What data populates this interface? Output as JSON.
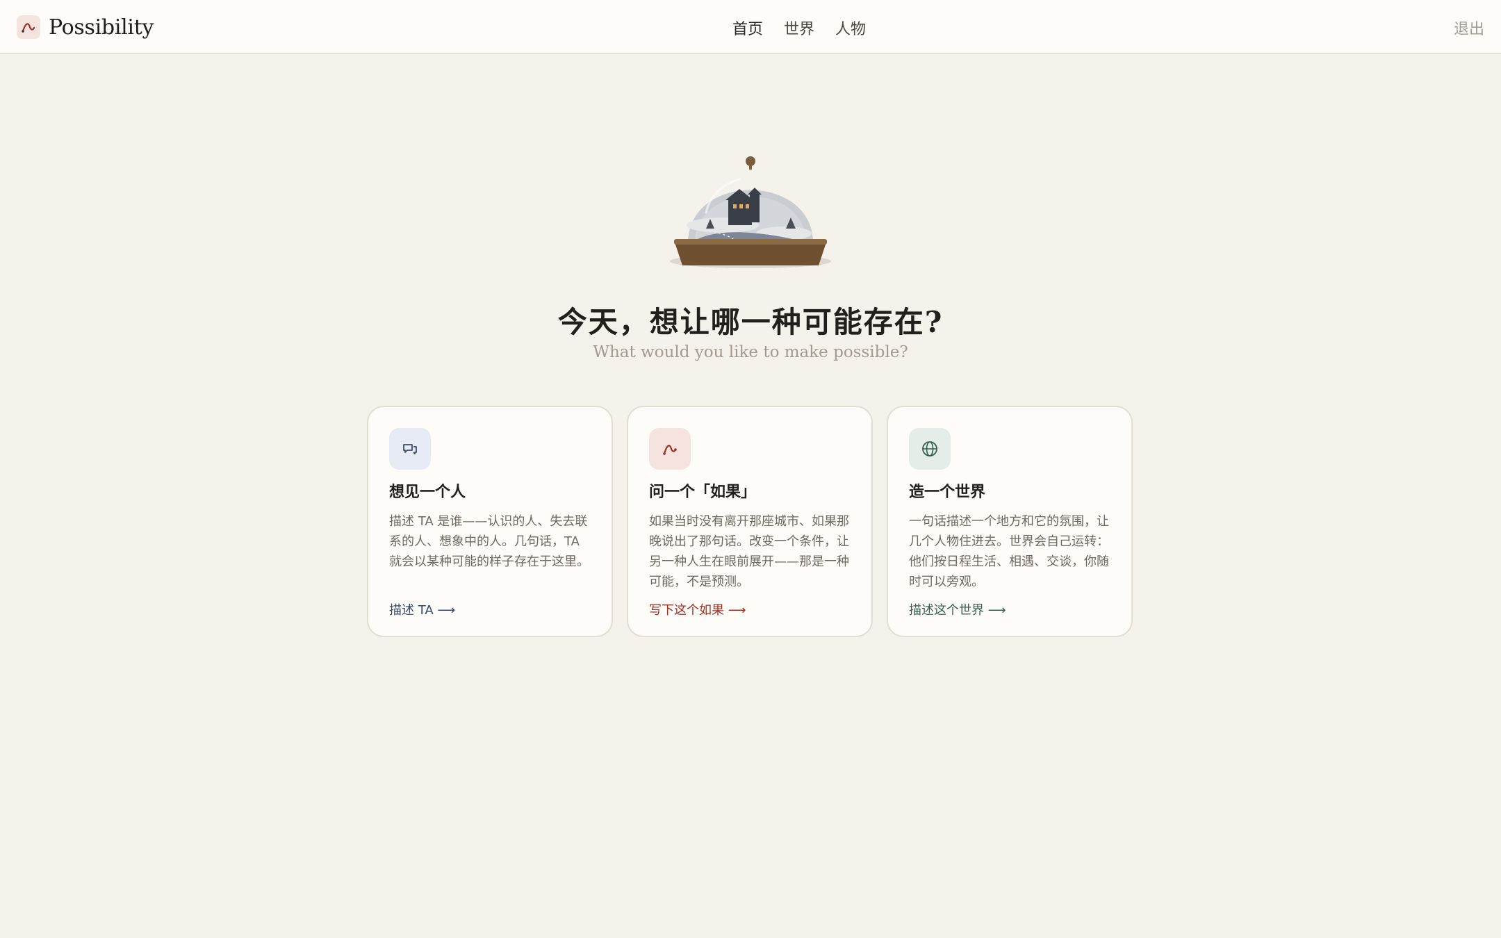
{
  "app": {
    "name": "Possibility",
    "logo_icon": "curve-icon",
    "accent": "#9c2f22"
  },
  "nav": {
    "items": [
      {
        "label": "首页",
        "active": true
      },
      {
        "label": "世界",
        "active": false
      },
      {
        "label": "人物",
        "active": false
      }
    ],
    "logout_label": "退出"
  },
  "hero": {
    "illustration": "snow-globe-house-illustration",
    "title": "今天，想让哪一种可能存在?",
    "subtitle": "What would you like to make possible?"
  },
  "cards": [
    {
      "icon": "chat-bubble-icon",
      "icon_color": "#3b4a6b",
      "icon_bg": "#e6ebf4",
      "title": "想见一个人",
      "description": "描述 TA 是谁——认识的人、失去联系的人、想象中的人。几句话，TA 就会以某种可能的样子存在于这里。",
      "link": "描述 TA ⟶",
      "link_color": "#34476e"
    },
    {
      "icon": "curve-icon",
      "icon_color": "#9c2f22",
      "icon_bg": "#f4e3df",
      "title": "问一个「如果」",
      "description": "如果当时没有离开那座城市、如果那晚说出了那句话。改变一个条件，让另一种人生在眼前展开——那是一种可能，不是预测。",
      "link": "写下这个如果 ⟶",
      "link_color": "#9c2f22"
    },
    {
      "icon": "globe-icon",
      "icon_color": "#35604d",
      "icon_bg": "#e4ede8",
      "title": "造一个世界",
      "description": "一句话描述一个地方和它的氛围，让几个人物住进去。世界会自己运转：他们按日程生活、相遇、交谈，你随时可以旁观。",
      "link": "描述这个世界 ⟶",
      "link_color": "#35604d"
    }
  ]
}
